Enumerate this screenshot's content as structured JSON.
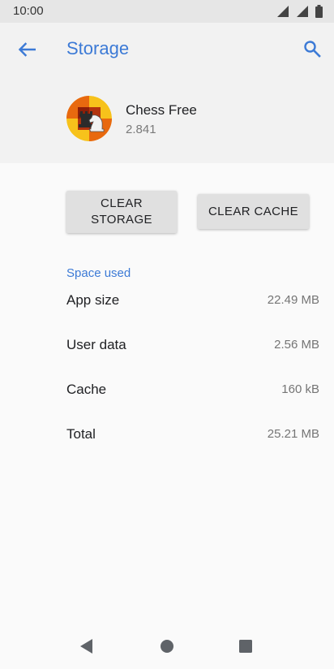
{
  "status_bar": {
    "time": "10:00",
    "icons": [
      "wifi-icon",
      "signal-icon",
      "battery-icon"
    ]
  },
  "header": {
    "title": "Storage",
    "back_icon": "arrow-left-icon",
    "search_icon": "search-icon"
  },
  "app": {
    "name": "Chess Free",
    "version": "2.841",
    "icon": "chess-app-icon"
  },
  "actions": {
    "clear_storage_line1": "CLEAR",
    "clear_storage_line2": "STORAGE",
    "clear_cache": "CLEAR CACHE"
  },
  "space_used": {
    "title": "Space used",
    "rows": [
      {
        "label": "App size",
        "value": "22.49 MB"
      },
      {
        "label": "User data",
        "value": "2.56 MB"
      },
      {
        "label": "Cache",
        "value": "160 kB"
      },
      {
        "label": "Total",
        "value": "25.21 MB"
      }
    ]
  },
  "nav_bar": {
    "icons": [
      "back-triangle-icon",
      "home-circle-icon",
      "recents-square-icon"
    ]
  },
  "colors": {
    "accent": "#3c7ad6",
    "header_bg": "#f2f2f2",
    "status_bg": "#e6e6e6",
    "button_bg": "#e0e0e0"
  }
}
